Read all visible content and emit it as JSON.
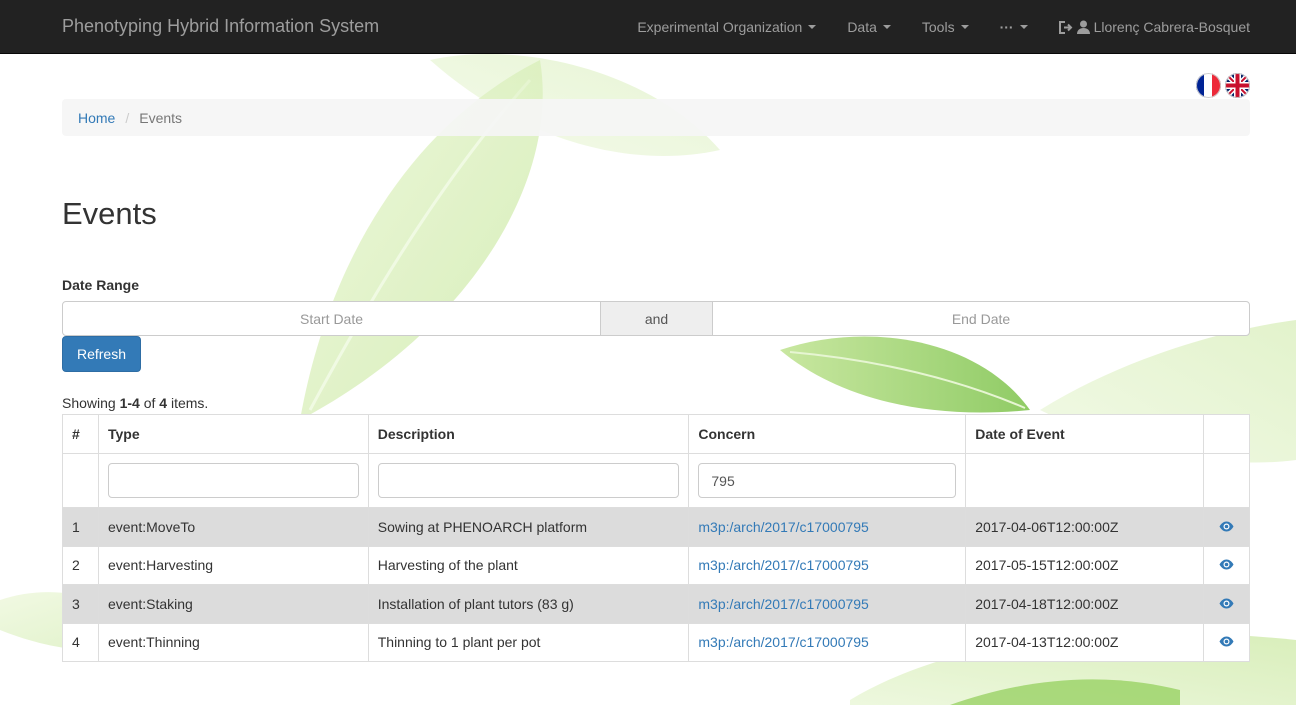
{
  "navbar": {
    "brand": "Phenotyping Hybrid Information System",
    "items": [
      {
        "label": "Experimental Organization"
      },
      {
        "label": "Data"
      },
      {
        "label": "Tools"
      },
      {
        "label": "···"
      }
    ],
    "user": "Llorenç Cabrera-Bosquet"
  },
  "flags": [
    "french-flag-icon",
    "uk-flag-icon"
  ],
  "breadcrumb": {
    "home": "Home",
    "current": "Events"
  },
  "page": {
    "title": "Events"
  },
  "date_range": {
    "label": "Date Range",
    "start_placeholder": "Start Date",
    "separator": "and",
    "end_placeholder": "End Date"
  },
  "buttons": {
    "refresh": "Refresh"
  },
  "summary": {
    "prefix": "Showing ",
    "range": "1-4",
    "of": " of ",
    "total": "4",
    "suffix": " items."
  },
  "table": {
    "headers": {
      "num": "#",
      "type": "Type",
      "description": "Description",
      "concern": "Concern",
      "date": "Date of Event"
    },
    "filters": {
      "type": "",
      "description": "",
      "concern": "795"
    },
    "rows": [
      {
        "num": "1",
        "type": "event:MoveTo",
        "description": "Sowing at PHENOARCH platform",
        "concern": "m3p:/arch/2017/c17000795",
        "date": "2017-04-06T12:00:00Z"
      },
      {
        "num": "2",
        "type": "event:Harvesting",
        "description": "Harvesting of the plant",
        "concern": "m3p:/arch/2017/c17000795",
        "date": "2017-05-15T12:00:00Z"
      },
      {
        "num": "3",
        "type": "event:Staking",
        "description": "Installation of plant tutors (83 g)",
        "concern": "m3p:/arch/2017/c17000795",
        "date": "2017-04-18T12:00:00Z"
      },
      {
        "num": "4",
        "type": "event:Thinning",
        "description": "Thinning to 1 plant per pot",
        "concern": "m3p:/arch/2017/c17000795",
        "date": "2017-04-13T12:00:00Z"
      }
    ]
  },
  "colors": {
    "navbar": "#222222",
    "primary": "#337ab7",
    "stripe": "#dcdcdc"
  }
}
